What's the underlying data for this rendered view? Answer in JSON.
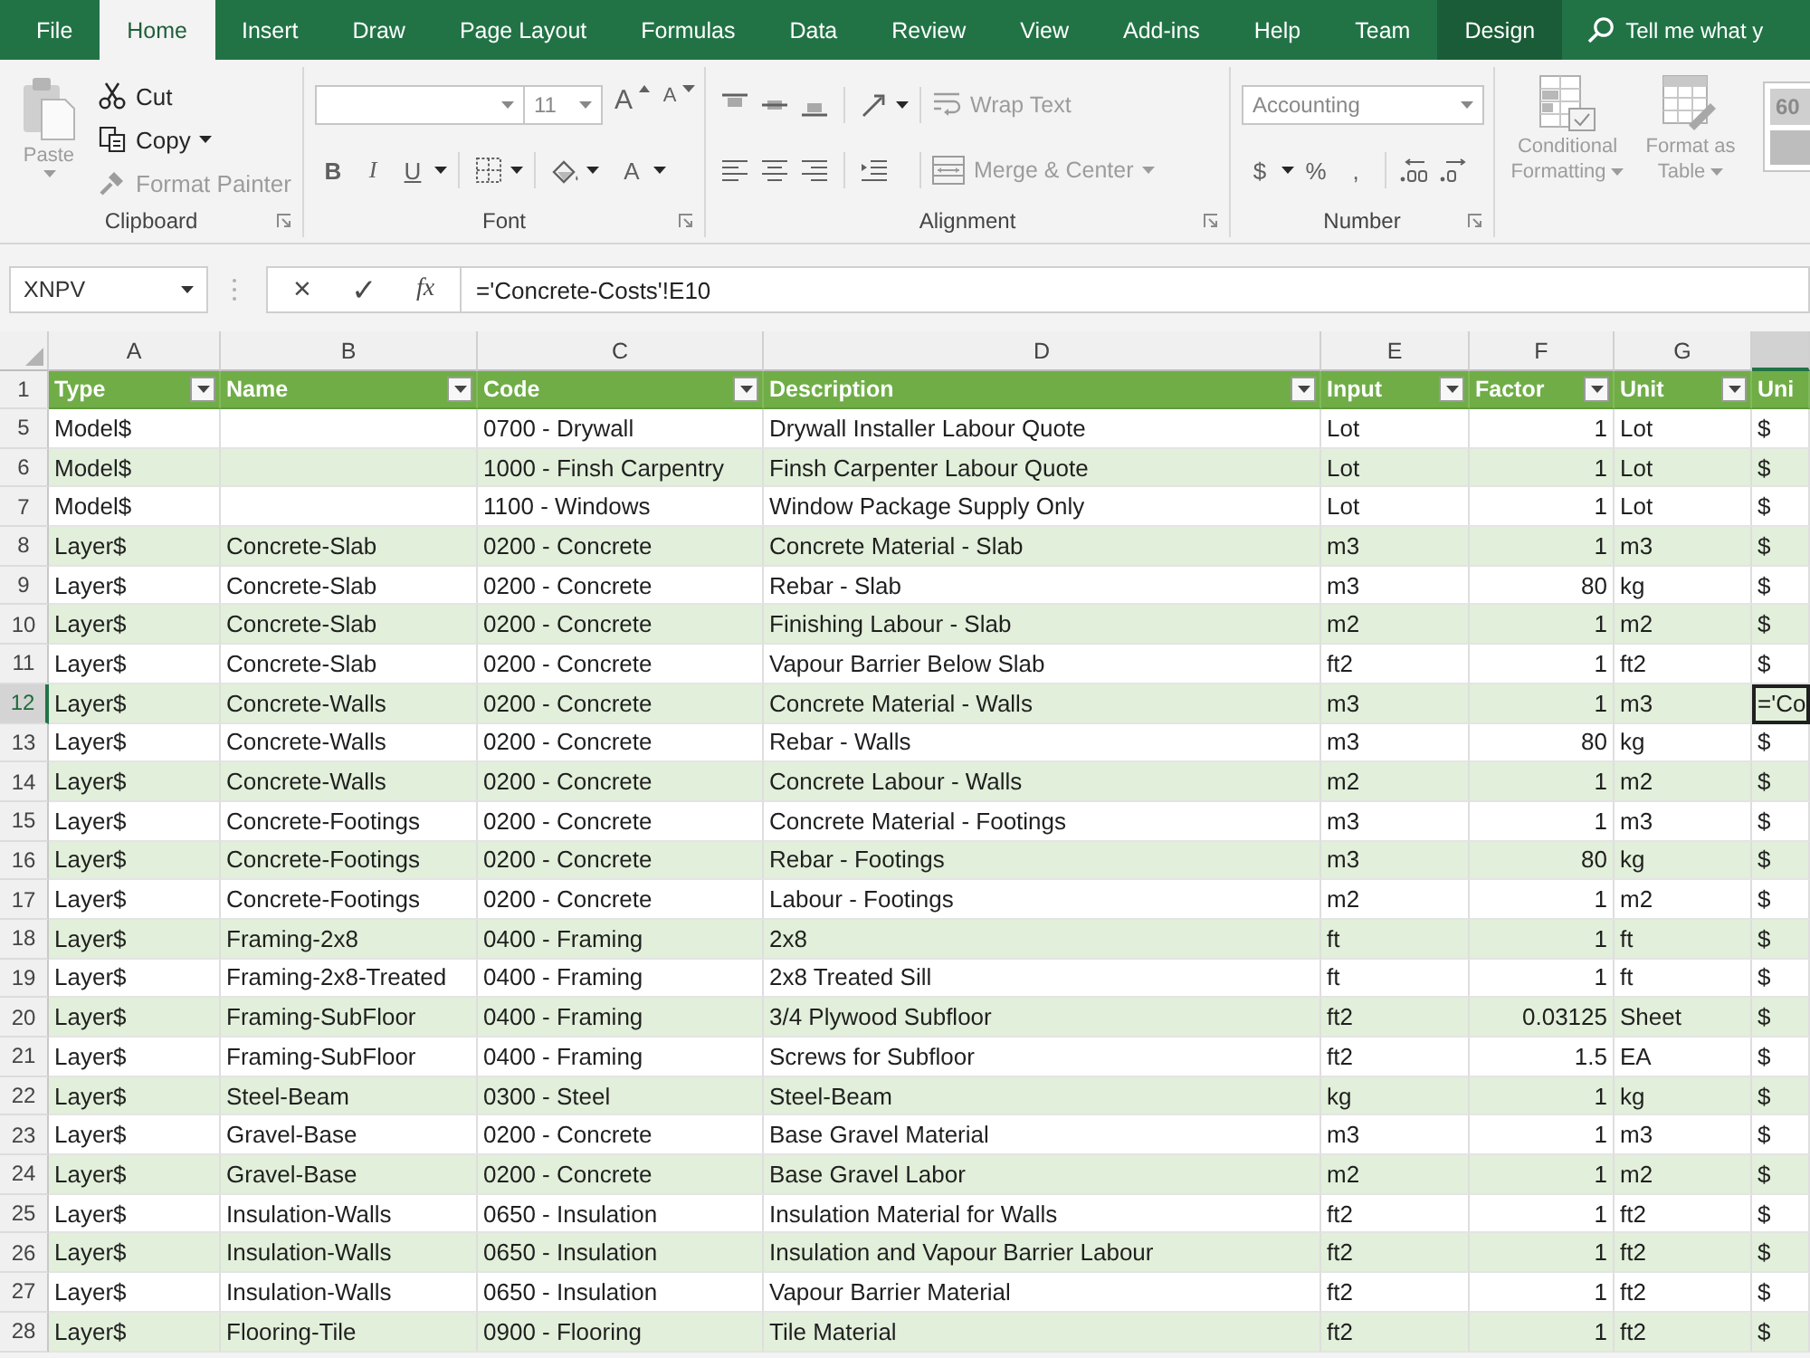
{
  "ribbon_tabs": [
    {
      "label": "File",
      "kind": "standard",
      "selected": false
    },
    {
      "label": "Home",
      "kind": "standard",
      "selected": true
    },
    {
      "label": "Insert",
      "kind": "standard",
      "selected": false
    },
    {
      "label": "Draw",
      "kind": "standard",
      "selected": false
    },
    {
      "label": "Page Layout",
      "kind": "standard",
      "selected": false
    },
    {
      "label": "Formulas",
      "kind": "standard",
      "selected": false
    },
    {
      "label": "Data",
      "kind": "standard",
      "selected": false
    },
    {
      "label": "Review",
      "kind": "standard",
      "selected": false
    },
    {
      "label": "View",
      "kind": "standard",
      "selected": false
    },
    {
      "label": "Add-ins",
      "kind": "standard",
      "selected": false
    },
    {
      "label": "Help",
      "kind": "standard",
      "selected": false
    },
    {
      "label": "Team",
      "kind": "standard",
      "selected": false
    },
    {
      "label": "Design",
      "kind": "contextual",
      "selected": false
    }
  ],
  "tell_me": {
    "label": "Tell me what y"
  },
  "ribbon": {
    "clipboard": {
      "label": "Clipboard",
      "paste": {
        "label": "Paste",
        "disabled": true
      },
      "commands": [
        {
          "label": "Cut",
          "kind": "cut",
          "disabled": false
        },
        {
          "label": "Copy",
          "kind": "copy",
          "disabled": false
        },
        {
          "label": "Format Painter",
          "kind": "painter",
          "disabled": true
        }
      ]
    },
    "font": {
      "label": "Font",
      "font_size": "11",
      "size_buttons": [
        "A",
        "A"
      ],
      "styles": [
        "B",
        "I",
        "U"
      ],
      "font_color": "A"
    },
    "alignment": {
      "label": "Alignment",
      "commands": [
        {
          "label": "Wrap Text",
          "kind": "wrap",
          "disabled": true
        },
        {
          "label": "Merge & Center",
          "kind": "merge",
          "disabled": true
        }
      ]
    },
    "number": {
      "label": "Number",
      "format": "Accounting",
      "symbols": [
        "$",
        "%",
        ","
      ]
    },
    "styles": {
      "commands": [
        {
          "label": "Conditional Formatting",
          "kind": "conditional",
          "disabled": true
        },
        {
          "label": "Format as Table",
          "kind": "table",
          "disabled": true
        }
      ],
      "gallery_preview": "60"
    }
  },
  "formula_bar": {
    "name_box": "XNPV",
    "buttons": [
      "×",
      "✓",
      "fx"
    ],
    "formula": "='Concrete-Costs'!E10"
  },
  "sheet": {
    "column_letters": [
      "A",
      "B",
      "C",
      "D",
      "E",
      "F",
      "G"
    ],
    "column_h": {
      "selected": true
    },
    "header_row": {
      "number": "1",
      "titles": [
        "Type",
        "Name",
        "Code",
        "Description",
        "Input",
        "Factor",
        "Unit"
      ],
      "cut_title": "Uni"
    },
    "rows": [
      {
        "number": "5",
        "type": "Model$",
        "code": "0700 - Drywall",
        "description": "Drywall Installer Labour Quote",
        "input": "Lot",
        "factor": "1",
        "unit": "Lot",
        "column_h": "$",
        "selected": false
      },
      {
        "number": "6",
        "type": "Model$",
        "code": "1000 - Finsh Carpentry",
        "description": "Finsh Carpenter Labour Quote",
        "input": "Lot",
        "factor": "1",
        "unit": "Lot",
        "column_h": "$",
        "selected": false
      },
      {
        "number": "7",
        "type": "Model$",
        "code": "1100 - Windows",
        "description": "Window Package Supply Only",
        "input": "Lot",
        "factor": "1",
        "unit": "Lot",
        "column_h": "$",
        "selected": false
      },
      {
        "number": "8",
        "type": "Layer$",
        "name": "Concrete-Slab",
        "code": "0200 - Concrete",
        "description": "Concrete Material - Slab",
        "input": "m3",
        "factor": "1",
        "unit": "m3",
        "column_h": "$",
        "selected": false
      },
      {
        "number": "9",
        "type": "Layer$",
        "name": "Concrete-Slab",
        "code": "0200 - Concrete",
        "description": "Rebar - Slab",
        "input": "m3",
        "factor": "80",
        "unit": "kg",
        "column_h": "$",
        "selected": false
      },
      {
        "number": "10",
        "type": "Layer$",
        "name": "Concrete-Slab",
        "code": "0200 - Concrete",
        "description": "Finishing Labour - Slab",
        "input": "m2",
        "factor": "1",
        "unit": "m2",
        "column_h": "$",
        "selected": false
      },
      {
        "number": "11",
        "type": "Layer$",
        "name": "Concrete-Slab",
        "code": "0200 - Concrete",
        "description": "Vapour Barrier Below Slab",
        "input": "ft2",
        "factor": "1",
        "unit": "ft2",
        "column_h": "$",
        "selected": false
      },
      {
        "number": "12",
        "type": "Layer$",
        "name": "Concrete-Walls",
        "code": "0200 - Concrete",
        "description": "Concrete Material - Walls",
        "input": "m3",
        "factor": "1",
        "unit": "m3",
        "column_h": "='Co",
        "selected": true
      },
      {
        "number": "13",
        "type": "Layer$",
        "name": "Concrete-Walls",
        "code": "0200 - Concrete",
        "description": "Rebar - Walls",
        "input": "m3",
        "factor": "80",
        "unit": "kg",
        "column_h": "$",
        "selected": false
      },
      {
        "number": "14",
        "type": "Layer$",
        "name": "Concrete-Walls",
        "code": "0200 - Concrete",
        "description": "Concrete Labour - Walls",
        "input": "m2",
        "factor": "1",
        "unit": "m2",
        "column_h": "$",
        "selected": false
      },
      {
        "number": "15",
        "type": "Layer$",
        "name": "Concrete-Footings",
        "code": "0200 - Concrete",
        "description": "Concrete Material - Footings",
        "input": "m3",
        "factor": "1",
        "unit": "m3",
        "column_h": "$",
        "selected": false
      },
      {
        "number": "16",
        "type": "Layer$",
        "name": "Concrete-Footings",
        "code": "0200 - Concrete",
        "description": "Rebar - Footings",
        "input": "m3",
        "factor": "80",
        "unit": "kg",
        "column_h": "$",
        "selected": false
      },
      {
        "number": "17",
        "type": "Layer$",
        "name": "Concrete-Footings",
        "code": "0200 - Concrete",
        "description": "Labour - Footings",
        "input": "m2",
        "factor": "1",
        "unit": "m2",
        "column_h": "$",
        "selected": false
      },
      {
        "number": "18",
        "type": "Layer$",
        "name": "Framing-2x8",
        "code": "0400 - Framing",
        "description": "2x8",
        "input": "ft",
        "factor": "1",
        "unit": "ft",
        "column_h": "$",
        "selected": false
      },
      {
        "number": "19",
        "type": "Layer$",
        "name": "Framing-2x8-Treated",
        "code": "0400 - Framing",
        "description": "2x8 Treated Sill",
        "input": "ft",
        "factor": "1",
        "unit": "ft",
        "column_h": "$",
        "selected": false
      },
      {
        "number": "20",
        "type": "Layer$",
        "name": "Framing-SubFloor",
        "code": "0400 - Framing",
        "description": "3/4 Plywood Subfloor",
        "input": "ft2",
        "factor": "0.03125",
        "unit": "Sheet",
        "column_h": "$",
        "selected": false
      },
      {
        "number": "21",
        "type": "Layer$",
        "name": "Framing-SubFloor",
        "code": "0400 - Framing",
        "description": "Screws for Subfloor",
        "input": "ft2",
        "factor": "1.5",
        "unit": "EA",
        "column_h": "$",
        "selected": false
      },
      {
        "number": "22",
        "type": "Layer$",
        "name": "Steel-Beam",
        "code": "0300 - Steel",
        "description": "Steel-Beam",
        "input": "kg",
        "factor": "1",
        "unit": "kg",
        "column_h": "$",
        "selected": false
      },
      {
        "number": "23",
        "type": "Layer$",
        "name": "Gravel-Base",
        "code": "0200 - Concrete",
        "description": "Base Gravel Material",
        "input": "m3",
        "factor": "1",
        "unit": "m3",
        "column_h": "$",
        "selected": false
      },
      {
        "number": "24",
        "type": "Layer$",
        "name": "Gravel-Base",
        "code": "0200 - Concrete",
        "description": "Base Gravel Labor",
        "input": "m2",
        "factor": "1",
        "unit": "m2",
        "column_h": "$",
        "selected": false
      },
      {
        "number": "25",
        "type": "Layer$",
        "name": "Insulation-Walls",
        "code": "0650 - Insulation",
        "description": "Insulation Material for Walls",
        "input": "ft2",
        "factor": "1",
        "unit": "ft2",
        "column_h": "$",
        "selected": false
      },
      {
        "number": "26",
        "type": "Layer$",
        "name": "Insulation-Walls",
        "code": "0650 - Insulation",
        "description": "Insulation and Vapour Barrier Labour",
        "input": "ft2",
        "factor": "1",
        "unit": "ft2",
        "column_h": "$",
        "selected": false
      },
      {
        "number": "27",
        "type": "Layer$",
        "name": "Insulation-Walls",
        "code": "0650 - Insulation",
        "description": "Vapour Barrier Material",
        "input": "ft2",
        "factor": "1",
        "unit": "ft2",
        "column_h": "$",
        "selected": false
      },
      {
        "number": "28",
        "type": "Layer$",
        "name": "Flooring-Tile",
        "code": "0900 - Flooring",
        "description": "Tile Material",
        "input": "ft2",
        "factor": "1",
        "unit": "ft2",
        "column_h": "$",
        "selected": false
      }
    ]
  }
}
